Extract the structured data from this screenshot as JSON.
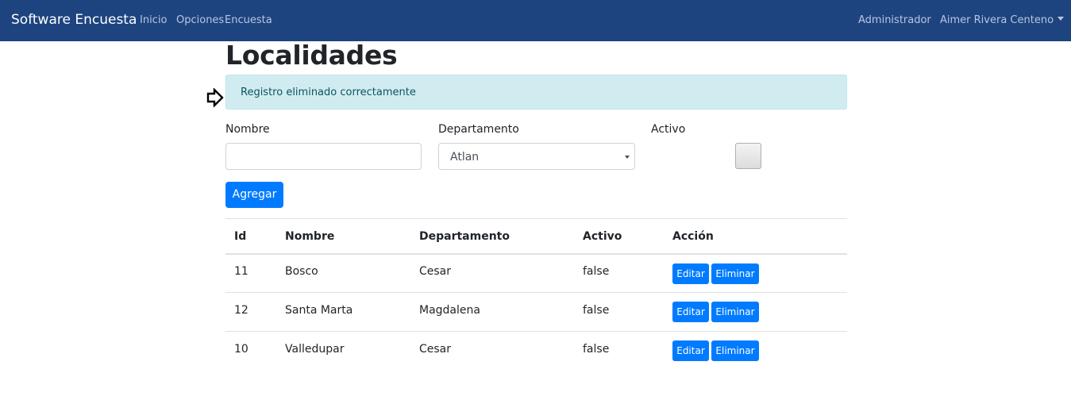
{
  "navbar": {
    "brand": "Software Encuesta",
    "links": [
      "Inicio",
      "Opciones",
      "Encuesta"
    ],
    "role": "Administrador",
    "user": "Aimer Rivera Centeno"
  },
  "page": {
    "title": "Localidades"
  },
  "alert": {
    "message": "Registro eliminado correctamente"
  },
  "form": {
    "nombre_label": "Nombre",
    "nombre_value": "",
    "departamento_label": "Departamento",
    "departamento_selected": "Atlan",
    "activo_label": "Activo",
    "activo_checked": false,
    "add_button": "Agregar"
  },
  "table": {
    "headers": [
      "Id",
      "Nombre",
      "Departamento",
      "Activo",
      "Acción"
    ],
    "rows": [
      {
        "id": "11",
        "nombre": "Bosco",
        "departamento": "Cesar",
        "activo": "false"
      },
      {
        "id": "12",
        "nombre": "Santa Marta",
        "departamento": "Magdalena",
        "activo": "false"
      },
      {
        "id": "10",
        "nombre": "Valledupar",
        "departamento": "Cesar",
        "activo": "false"
      }
    ],
    "edit_label": "Editar",
    "delete_label": "Eliminar"
  }
}
